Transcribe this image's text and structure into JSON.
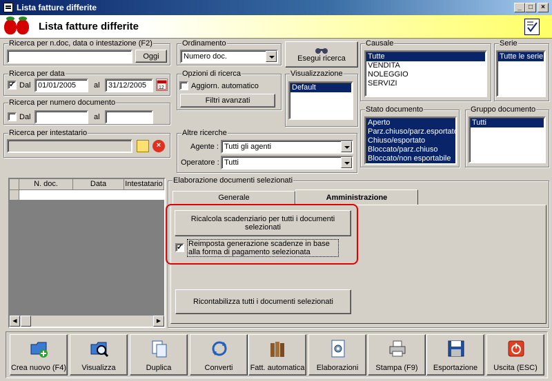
{
  "window": {
    "title": "Lista fatture differite",
    "banner_title": "Lista fatture differite"
  },
  "search_text": {
    "label": "Ricerca per n.doc, data o intestazione (F2)",
    "value": "",
    "today_button": "Oggi"
  },
  "search_date": {
    "label": "Ricerca per data",
    "from_label": "Dal",
    "from_value": "01/01/2005",
    "to_label": "al",
    "to_value": "31/12/2005",
    "checked": true
  },
  "search_number": {
    "label": "Ricerca per numero documento",
    "from_label": "Dal",
    "to_label": "al"
  },
  "search_holder": {
    "label": "Ricerca per intestatario"
  },
  "ordering": {
    "label": "Ordinamento",
    "value": "Numero doc."
  },
  "run_search": {
    "label": "Esegui ricerca"
  },
  "search_options": {
    "label": "Opzioni di ricerca",
    "auto_update": "Aggiorn. automatico",
    "advanced_filters": "Filtri avanzati"
  },
  "view": {
    "label": "Visualizzazione",
    "items": [
      "Default"
    ]
  },
  "other_searches": {
    "label": "Altre ricerche",
    "agent_label": "Agente :",
    "agent_value": "Tutti gli agenti",
    "operator_label": "Operatore :",
    "operator_value": "Tutti"
  },
  "reason": {
    "label": "Causale",
    "items": [
      "Tutte",
      "VENDITA",
      "NOLEGGIO",
      "SERVIZI"
    ]
  },
  "series": {
    "label": "Serie",
    "items": [
      "Tutte le serie"
    ]
  },
  "doc_state": {
    "label": "Stato documento",
    "items": [
      "Aperto",
      "Parz.chiuso/parz.esportato",
      "Chiuso/esportato",
      "Bloccato/parz.chiuso",
      "Bloccato/non esportabile"
    ]
  },
  "doc_group": {
    "label": "Gruppo documento",
    "items": [
      "Tutti"
    ]
  },
  "grid": {
    "columns": [
      "N. doc.",
      "Data",
      "Intestatario"
    ]
  },
  "processing": {
    "label": "Elaborazione documenti selezionati",
    "tabs": [
      "Generale",
      "Amministrazione"
    ],
    "recalc_button": "Ricalcola scadenziario per tutti i documenti selezionati",
    "reset_check": "Reimposta generazione scadenze in base alla forma di pagamento selezionata",
    "recount_button": "Ricontabilizza tutti i documenti selezionati"
  },
  "toolbar": [
    {
      "label": "Crea nuovo (F4)",
      "icon": "folder-add-icon"
    },
    {
      "label": "Visualizza",
      "icon": "folder-search-icon"
    },
    {
      "label": "Duplica",
      "icon": "duplicate-icon"
    },
    {
      "label": "Converti",
      "icon": "convert-icon"
    },
    {
      "label": "Fatt. automatica",
      "icon": "binders-icon"
    },
    {
      "label": "Elaborazioni",
      "icon": "gear-document-icon"
    },
    {
      "label": "Stampa (F9)",
      "icon": "printer-icon"
    },
    {
      "label": "Esportazione",
      "icon": "floppy-icon"
    },
    {
      "label": "Uscita (ESC)",
      "icon": "exit-icon"
    }
  ],
  "colors": {
    "title_bar": "#0a246a",
    "selection": "#0a246a",
    "highlight_border": "#e00000",
    "face": "#d4d0c8"
  }
}
